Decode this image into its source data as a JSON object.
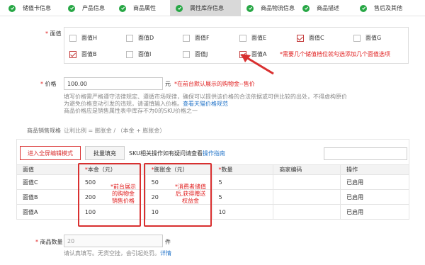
{
  "tabs": [
    {
      "label": "储值卡信息",
      "active": false
    },
    {
      "label": "产品信息",
      "active": false
    },
    {
      "label": "商品属性",
      "active": false
    },
    {
      "label": "属性库存信息",
      "active": true
    },
    {
      "label": "商品物流信息",
      "active": false
    },
    {
      "label": "商品描述",
      "active": false
    },
    {
      "label": "售后及其他",
      "active": false
    }
  ],
  "face_value": {
    "label": "面值",
    "options": [
      {
        "label": "面值H",
        "checked": false
      },
      {
        "label": "面值D",
        "checked": false
      },
      {
        "label": "面值F",
        "checked": false
      },
      {
        "label": "面值E",
        "checked": false
      },
      {
        "label": "面值C",
        "checked": true
      },
      {
        "label": "面值G",
        "checked": false
      },
      {
        "label": "面值B",
        "checked": true
      },
      {
        "label": "面值I",
        "checked": false
      },
      {
        "label": "面值J",
        "checked": false
      },
      {
        "label": "面值A",
        "checked": true
      }
    ],
    "annotation": "*需要几个储值档位就勾选添加几个面值选项"
  },
  "price": {
    "label": "价格",
    "value": "100.00",
    "unit": "元",
    "annotation": "*在前台默认展示的购物金--售价",
    "help_line1": "填写价格需严格遵守法律规定、遵循市场规律，确保可以提供该价格的合法依据或可供比较的出处，不得虚构原价",
    "help_line2_prefix": "为避免价格变动引发的违规，请谨慎输入价格。",
    "help_link": "查看天猫价格规范",
    "help_line3": "商品价格应是销售属性表中库存不为0的SKU价格之一"
  },
  "sku": {
    "section_label": "商品销售规格",
    "ratio_text": "让利比例 = 膨胀金 / （本金 + 膨胀金）",
    "edit_mode_button": "进入全屏编辑模式",
    "batch_fill_button": "批量填充",
    "help_text": "SKU相关操作如有疑问请查看",
    "help_link": "操作指南",
    "columns": [
      "面值",
      "本金（元）",
      "膨胀金（元）",
      "数量",
      "商家编码",
      "操作"
    ],
    "rows": [
      {
        "face": "面值C",
        "principal": "500",
        "bonus": "50",
        "qty": "5",
        "code": "",
        "status": "已启用"
      },
      {
        "face": "面值B",
        "principal": "200",
        "bonus": "20",
        "qty": "5",
        "code": "",
        "status": "已启用"
      },
      {
        "face": "面值A",
        "principal": "100",
        "bonus": "10",
        "qty": "10",
        "code": "",
        "status": "已启用"
      }
    ],
    "principal_note": [
      "*前台展示",
      "的购物金",
      "销售价格"
    ],
    "bonus_note": [
      "*消费者储值",
      "后,获得赠送",
      "权益金"
    ]
  },
  "quantity": {
    "label": "商品数量",
    "value": "20",
    "unit": "件",
    "help_text": "请认真填写。无货空挂，会引起处罚。",
    "help_link": "详情"
  },
  "colors": {
    "accent_red": "#e02020",
    "check_green": "#27a745",
    "link_blue": "#2676c9"
  }
}
